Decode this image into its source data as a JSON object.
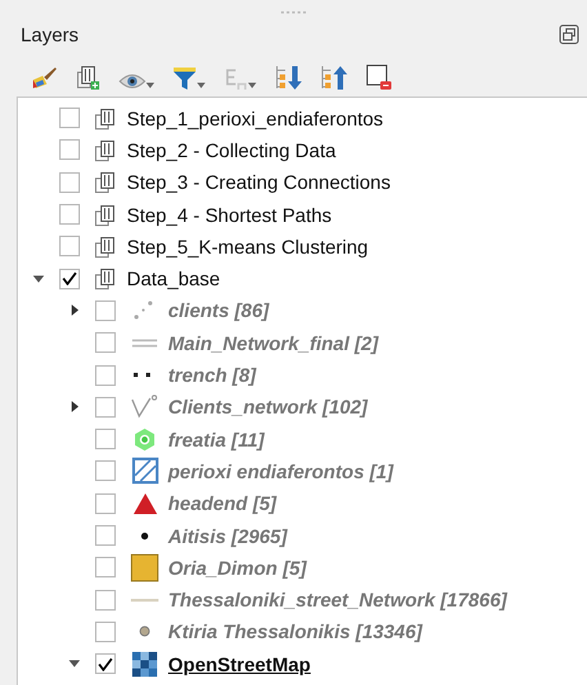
{
  "panel": {
    "title": "Layers"
  },
  "layers": [
    {
      "kind": "group",
      "name": "Step_1_perioxi_endiaferontos",
      "checked": false
    },
    {
      "kind": "group",
      "name": "Step_2 - Collecting Data",
      "checked": false
    },
    {
      "kind": "group",
      "name": "Step_3 - Creating Connections",
      "checked": false
    },
    {
      "kind": "group",
      "name": "Step_4 - Shortest Paths",
      "checked": false
    },
    {
      "kind": "group",
      "name": "Step_5_K-means Clustering",
      "checked": false
    },
    {
      "kind": "group",
      "name": "Data_base",
      "checked": true,
      "expanded": true,
      "children": [
        {
          "kind": "points",
          "name": "clients [86]",
          "checked": false,
          "expanded": false
        },
        {
          "kind": "double-line",
          "name": "Main_Network_final [2]",
          "checked": false
        },
        {
          "kind": "dashes",
          "name": "trench [8]",
          "checked": false
        },
        {
          "kind": "network",
          "name": "Clients_network [102]",
          "checked": false,
          "expanded": false
        },
        {
          "kind": "hexagon",
          "name": "freatia [11]",
          "checked": false
        },
        {
          "kind": "hatched",
          "name": "perioxi endiaferontos [1]",
          "checked": false
        },
        {
          "kind": "triangle",
          "name": "headend [5]",
          "checked": false
        },
        {
          "kind": "dot",
          "name": "Aitisis [2965]",
          "checked": false
        },
        {
          "kind": "square",
          "name": "Oria_Dimon [5]",
          "checked": false
        },
        {
          "kind": "line",
          "name": "Thessaloniki_street_Network [17866]",
          "checked": false
        },
        {
          "kind": "circle",
          "name": "Ktiria Thessalonikis [13346]",
          "checked": false
        },
        {
          "kind": "raster",
          "name": "OpenStreetMap",
          "checked": true,
          "expanded": true
        }
      ]
    }
  ]
}
